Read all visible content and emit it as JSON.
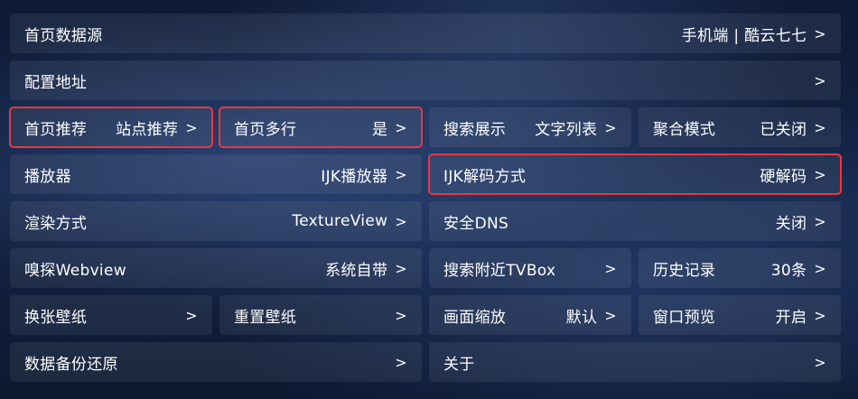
{
  "settings": {
    "home_source": {
      "label": "首页数据源",
      "value": "手机端 | 酷云七七",
      "chevron": ">"
    },
    "config_url": {
      "label": "配置地址",
      "value": "",
      "chevron": ">"
    },
    "home_recommend": {
      "label": "首页推荐",
      "value": "站点推荐",
      "chevron": ">"
    },
    "home_multirow": {
      "label": "首页多行",
      "value": "是",
      "chevron": ">"
    },
    "search_display": {
      "label": "搜索展示",
      "value": "文字列表",
      "chevron": ">"
    },
    "aggregate_mode": {
      "label": "聚合模式",
      "value": "已关闭",
      "chevron": ">"
    },
    "player": {
      "label": "播放器",
      "value": "IJK播放器",
      "chevron": ">"
    },
    "ijk_decode": {
      "label": "IJK解码方式",
      "value": "硬解码",
      "chevron": ">"
    },
    "render_mode": {
      "label": "渲染方式",
      "value": "TextureView",
      "chevron": ">"
    },
    "secure_dns": {
      "label": "安全DNS",
      "value": "关闭",
      "chevron": ">"
    },
    "sniff_webview": {
      "label": "嗅探Webview",
      "value": "系统自带",
      "chevron": ">"
    },
    "search_nearby": {
      "label": "搜索附近TVBox",
      "value": "",
      "chevron": ">"
    },
    "history": {
      "label": "历史记录",
      "value": "30条",
      "chevron": ">"
    },
    "change_wallpaper": {
      "label": "换张壁纸",
      "value": "",
      "chevron": ">"
    },
    "reset_wallpaper": {
      "label": "重置壁纸",
      "value": "",
      "chevron": ">"
    },
    "screen_scale": {
      "label": "画面缩放",
      "value": "默认",
      "chevron": ">"
    },
    "window_preview": {
      "label": "窗口预览",
      "value": "开启",
      "chevron": ">"
    },
    "backup_restore": {
      "label": "数据备份还原",
      "value": "",
      "chevron": ">"
    },
    "about": {
      "label": "关于",
      "value": "",
      "chevron": ">"
    }
  },
  "highlight_color": "#e8383f"
}
